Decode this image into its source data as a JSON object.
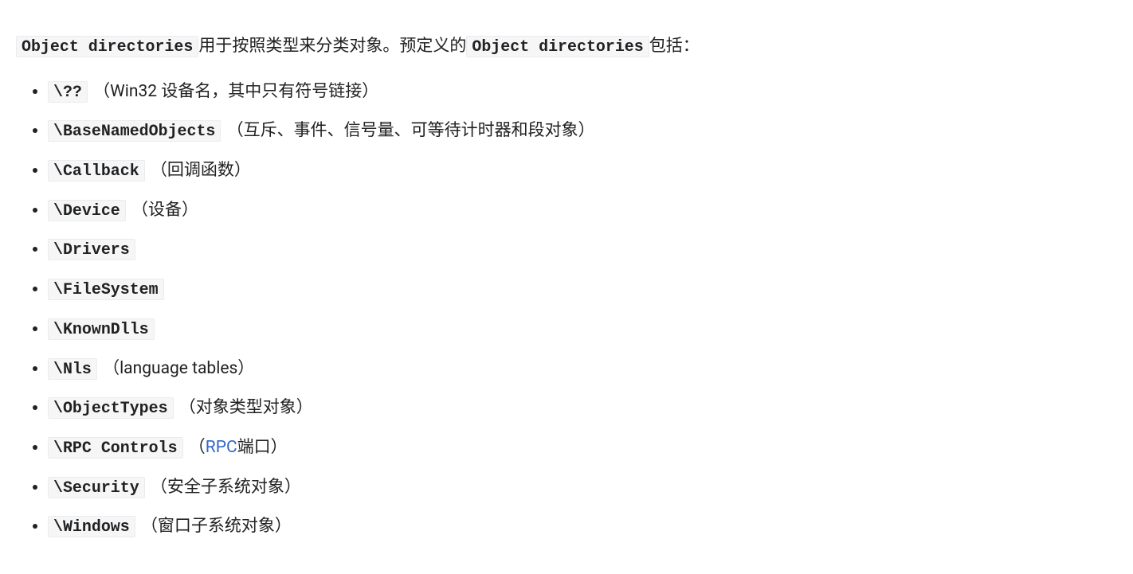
{
  "intro": {
    "code1": "Object directories",
    "text1": "用于按照类型来分类对象。预定义的",
    "code2": "Object directories",
    "text2": "包括："
  },
  "items": [
    {
      "code": "\\??",
      "note": "（Win32 设备名，其中只有符号链接）"
    },
    {
      "code": "\\BaseNamedObjects",
      "note": "（互斥、事件、信号量、可等待计时器和段对象）"
    },
    {
      "code": "\\Callback",
      "note": "（回调函数）"
    },
    {
      "code": "\\Device",
      "note": "（设备）"
    },
    {
      "code": "\\Drivers",
      "note": ""
    },
    {
      "code": "\\FileSystem",
      "note": ""
    },
    {
      "code": "\\KnownDlls",
      "note": ""
    },
    {
      "code": "\\Nls",
      "note": "（language tables）"
    },
    {
      "code": "\\ObjectTypes",
      "note": "（对象类型对象）"
    },
    {
      "code": "\\RPC Controls",
      "note_prefix": "（",
      "link": "RPC",
      "note_suffix": "端口）"
    },
    {
      "code": "\\Security",
      "note": "（安全子系统对象）"
    },
    {
      "code": "\\Windows",
      "note": "（窗口子系统对象）"
    }
  ]
}
